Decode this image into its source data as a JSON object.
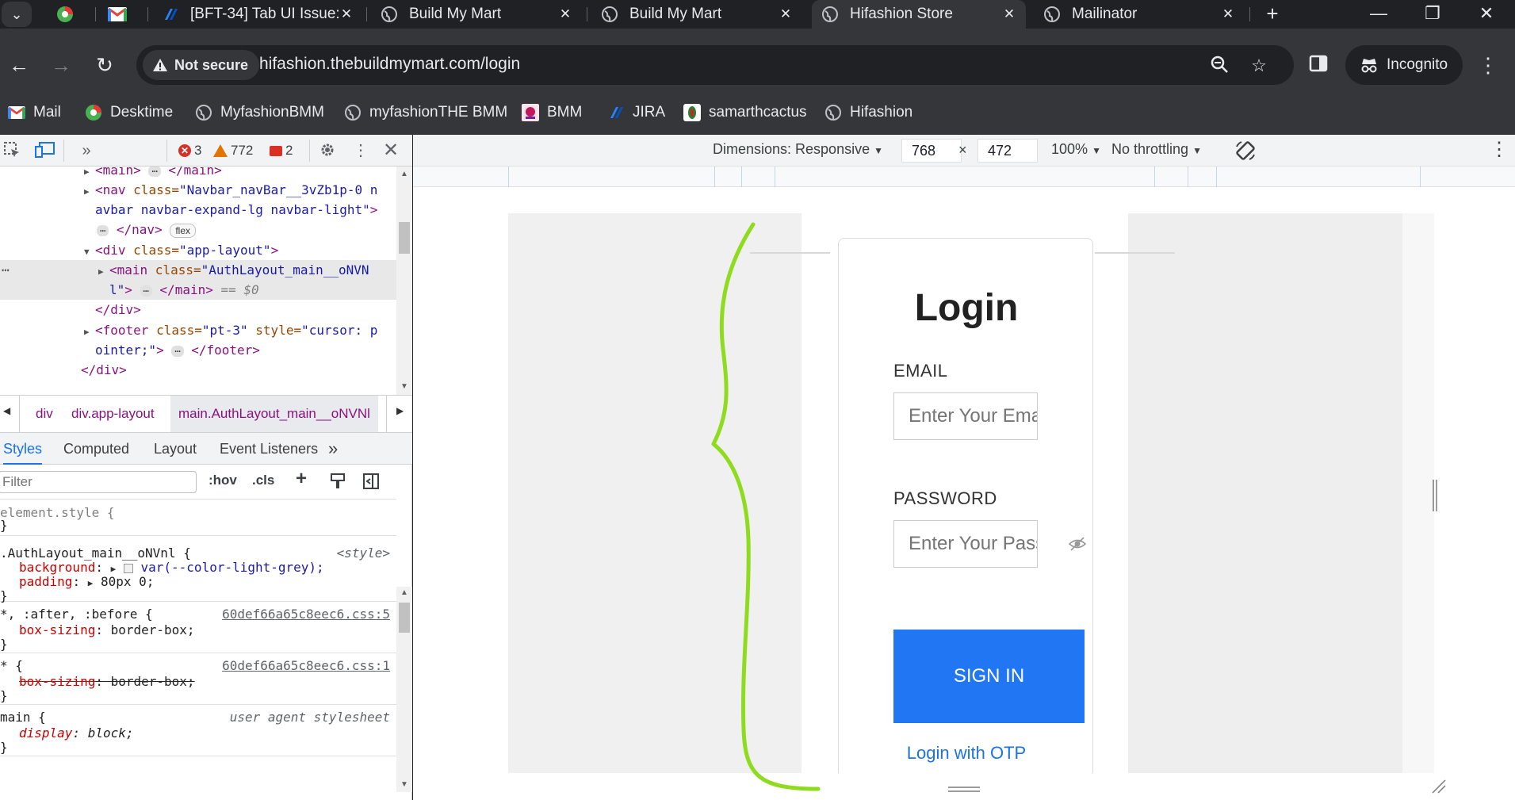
{
  "tabs": [
    {
      "title": "",
      "icon": "desktime-icon"
    },
    {
      "title": "",
      "icon": "gmail-icon"
    },
    {
      "title": "[BFT-34] Tab UI Issue:",
      "icon": "jira-icon"
    },
    {
      "title": "Build My Mart",
      "icon": "globe-icon"
    },
    {
      "title": "Build My Mart",
      "icon": "globe-icon"
    },
    {
      "title": "Hifashion Store",
      "icon": "globe-icon",
      "active": true
    },
    {
      "title": "Mailinator",
      "icon": "globe-icon"
    }
  ],
  "toolbar": {
    "not_secure": "Not secure",
    "url": "hifashion.thebuildmymart.com/login",
    "profile": "Incognito"
  },
  "bookmarks": [
    {
      "label": "Mail",
      "icon": "gmail-icon"
    },
    {
      "label": "Desktime",
      "icon": "desktime-icon"
    },
    {
      "label": "MyfashionBMM",
      "icon": "globe-icon"
    },
    {
      "label": "myfashionTHE BMM",
      "icon": "globe-icon"
    },
    {
      "label": "BMM",
      "icon": "bmm-icon"
    },
    {
      "label": "JIRA",
      "icon": "jira-icon"
    },
    {
      "label": "samarthcactus",
      "icon": "cactus-icon"
    },
    {
      "label": "Hifashion",
      "icon": "globe-icon"
    }
  ],
  "devtools": {
    "errors": "3",
    "warnings": "772",
    "issues": "2",
    "elements": {
      "line1_tag": "<main>",
      "line1_close": "</main>",
      "nav_open": "<nav ",
      "nav_attr": "class=",
      "nav_val1": "\"Navbar_navBar__3vZb1p-0 n",
      "nav_val2": "avbar navbar-expand-lg navbar-light\"",
      "nav_gt": ">",
      "nav_close": "</nav>",
      "flex_badge": "flex",
      "div_open": "<div ",
      "div_attr": "class=",
      "div_val": "\"app-layout\"",
      "div_gt": ">",
      "main_open": "<main ",
      "main_attr": "class=",
      "main_val1": "\"AuthLayout_main__oNVN",
      "main_val2": "l\"",
      "main_gt": ">",
      "main_close": "</main>",
      "selected_marker": "== $0",
      "div_close": "</div>",
      "footer_open": "<footer ",
      "footer_attr1": "class=",
      "footer_val1": "\"pt-3\"",
      "footer_attr2": " style=",
      "footer_val2a": "\"cursor: p",
      "footer_val2b": "ointer;\"",
      "footer_gt": ">",
      "footer_close": "</footer>",
      "outer_div_close": "</div>",
      "ellipsis": "⋯"
    },
    "breadcrumbs": [
      "div",
      "div.app-layout",
      "main.AuthLayout_main__oNVNl"
    ],
    "style_tabs": [
      "Styles",
      "Computed",
      "Layout",
      "Event Listeners"
    ],
    "filter_placeholder": "Filter",
    "hov": ":hov",
    "cls": ".cls",
    "rules": {
      "element_style": "element.style {",
      "close": "}",
      "auth_selector": ".AuthLayout_main__oNVnl {",
      "auth_source": "<style>",
      "background_prop": "background",
      "background_var": "var(--color-light-grey);",
      "padding_prop": "padding",
      "padding_val": "80px 0;",
      "pseudo_selector": "*, :after, :before {",
      "pseudo_source": "60def66a65c8eec6.css:5",
      "box_prop": "box-sizing",
      "box_val": "border-box;",
      "star_selector": "* {",
      "star_source": "60def66a65c8eec6.css:1",
      "main_selector": "main {",
      "main_source": "user agent stylesheet",
      "display_prop": "display",
      "display_val": "block;"
    }
  },
  "device_toolbar": {
    "dimensions": "Dimensions: Responsive",
    "width": "768",
    "times": "×",
    "height": "472",
    "zoom": "100%",
    "throttling": "No throttling"
  },
  "login_page": {
    "title": "Login",
    "email_label": "EMAIL",
    "email_placeholder": "Enter Your Email",
    "password_label": "PASSWORD",
    "password_placeholder": "Enter Your Password",
    "sign_in": "SIGN IN",
    "otp_link": "Login with OTP"
  },
  "colors": {
    "accent": "#2176f3",
    "annotation": "#8fdc1e",
    "link": "#1a73e8"
  }
}
